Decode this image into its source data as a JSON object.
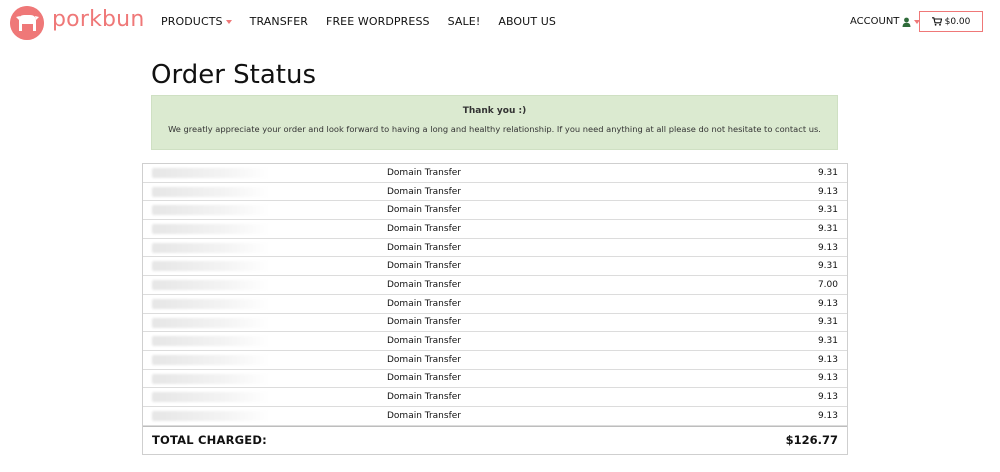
{
  "brand": {
    "name": "porkbun",
    "color": "#ef7878"
  },
  "nav": {
    "items": [
      {
        "label": "PRODUCTS",
        "has_dropdown": true
      },
      {
        "label": "TRANSFER",
        "has_dropdown": false
      },
      {
        "label": "FREE WORDPRESS",
        "has_dropdown": false
      },
      {
        "label": "SALE!",
        "has_dropdown": false
      },
      {
        "label": "ABOUT US",
        "has_dropdown": false
      }
    ]
  },
  "account": {
    "label": "ACCOUNT"
  },
  "cart": {
    "amount": "$0.00"
  },
  "page": {
    "title": "Order Status"
  },
  "alert": {
    "title": "Thank you :)",
    "text": "We greatly appreciate your order and look forward to having a long and healthy relationship. If you need anything at all please do not hesitate to contact us.",
    "background": "#dbead0"
  },
  "order": {
    "rows": [
      {
        "type": "Domain Transfer",
        "price": "9.31"
      },
      {
        "type": "Domain Transfer",
        "price": "9.13"
      },
      {
        "type": "Domain Transfer",
        "price": "9.31"
      },
      {
        "type": "Domain Transfer",
        "price": "9.31"
      },
      {
        "type": "Domain Transfer",
        "price": "9.13"
      },
      {
        "type": "Domain Transfer",
        "price": "9.31"
      },
      {
        "type": "Domain Transfer",
        "price": "7.00"
      },
      {
        "type": "Domain Transfer",
        "price": "9.13"
      },
      {
        "type": "Domain Transfer",
        "price": "9.31"
      },
      {
        "type": "Domain Transfer",
        "price": "9.31"
      },
      {
        "type": "Domain Transfer",
        "price": "9.13"
      },
      {
        "type": "Domain Transfer",
        "price": "9.13"
      },
      {
        "type": "Domain Transfer",
        "price": "9.13"
      },
      {
        "type": "Domain Transfer",
        "price": "9.13"
      }
    ],
    "total_label": "TOTAL CHARGED:",
    "total_value": "$126.77"
  }
}
